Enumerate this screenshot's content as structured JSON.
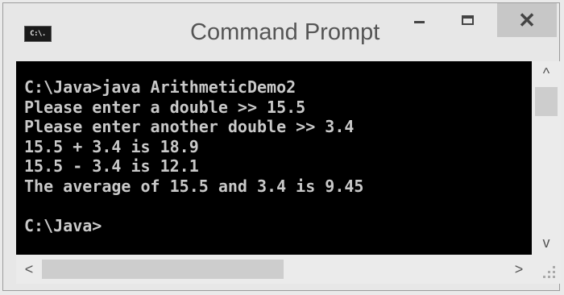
{
  "window": {
    "icon_text": "C:\\.",
    "title": "Command Prompt",
    "controls": {
      "close": "✕"
    }
  },
  "console": {
    "lines": [
      "C:\\Java>java ArithmeticDemo2",
      "Please enter a double >> 15.5",
      "Please enter another double >> 3.4",
      "15.5 + 3.4 is 18.9",
      "15.5 - 3.4 is 12.1",
      "The average of 15.5 and 3.4 is 9.45",
      "",
      "C:\\Java>"
    ]
  },
  "scrollbars": {
    "up_arrow": "^",
    "down_arrow": "v",
    "left_arrow": "<",
    "right_arrow": ">"
  },
  "icons": {
    "app": "command-prompt-icon",
    "minimize": "minimize-icon",
    "maximize": "maximize-icon",
    "close": "close-icon"
  }
}
